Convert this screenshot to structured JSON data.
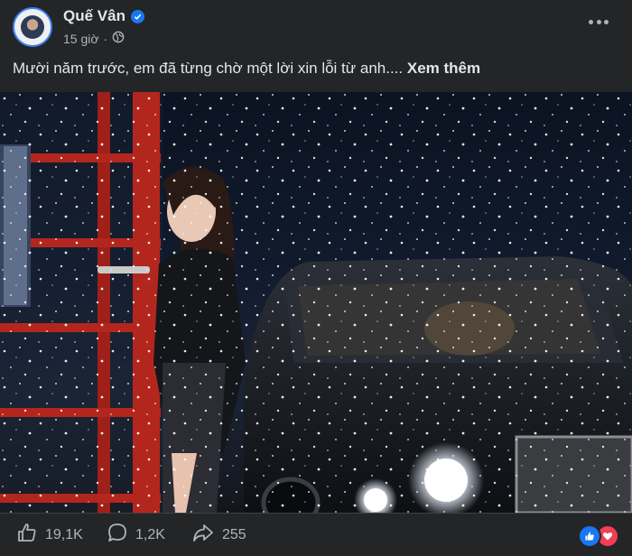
{
  "post": {
    "author": "Quế Vân",
    "time": "15 giờ",
    "caption": "Mười năm trước, em đã từng chờ một lời xin lỗi từ anh....",
    "see_more": "Xem thêm"
  },
  "stats": {
    "likes": "19,1K",
    "comments": "1,2K",
    "shares": "255"
  },
  "colors": {
    "background": "#242526",
    "text": "#e4e6eb",
    "secondary_text": "#b0b3b8",
    "verified": "#1877f2",
    "like_react": "#1877f2",
    "love_react": "#f33e58"
  },
  "icons": [
    "verified-icon",
    "globe-icon",
    "more-options-icon",
    "like-icon",
    "comment-icon",
    "share-icon",
    "like-reaction-icon",
    "love-reaction-icon"
  ]
}
